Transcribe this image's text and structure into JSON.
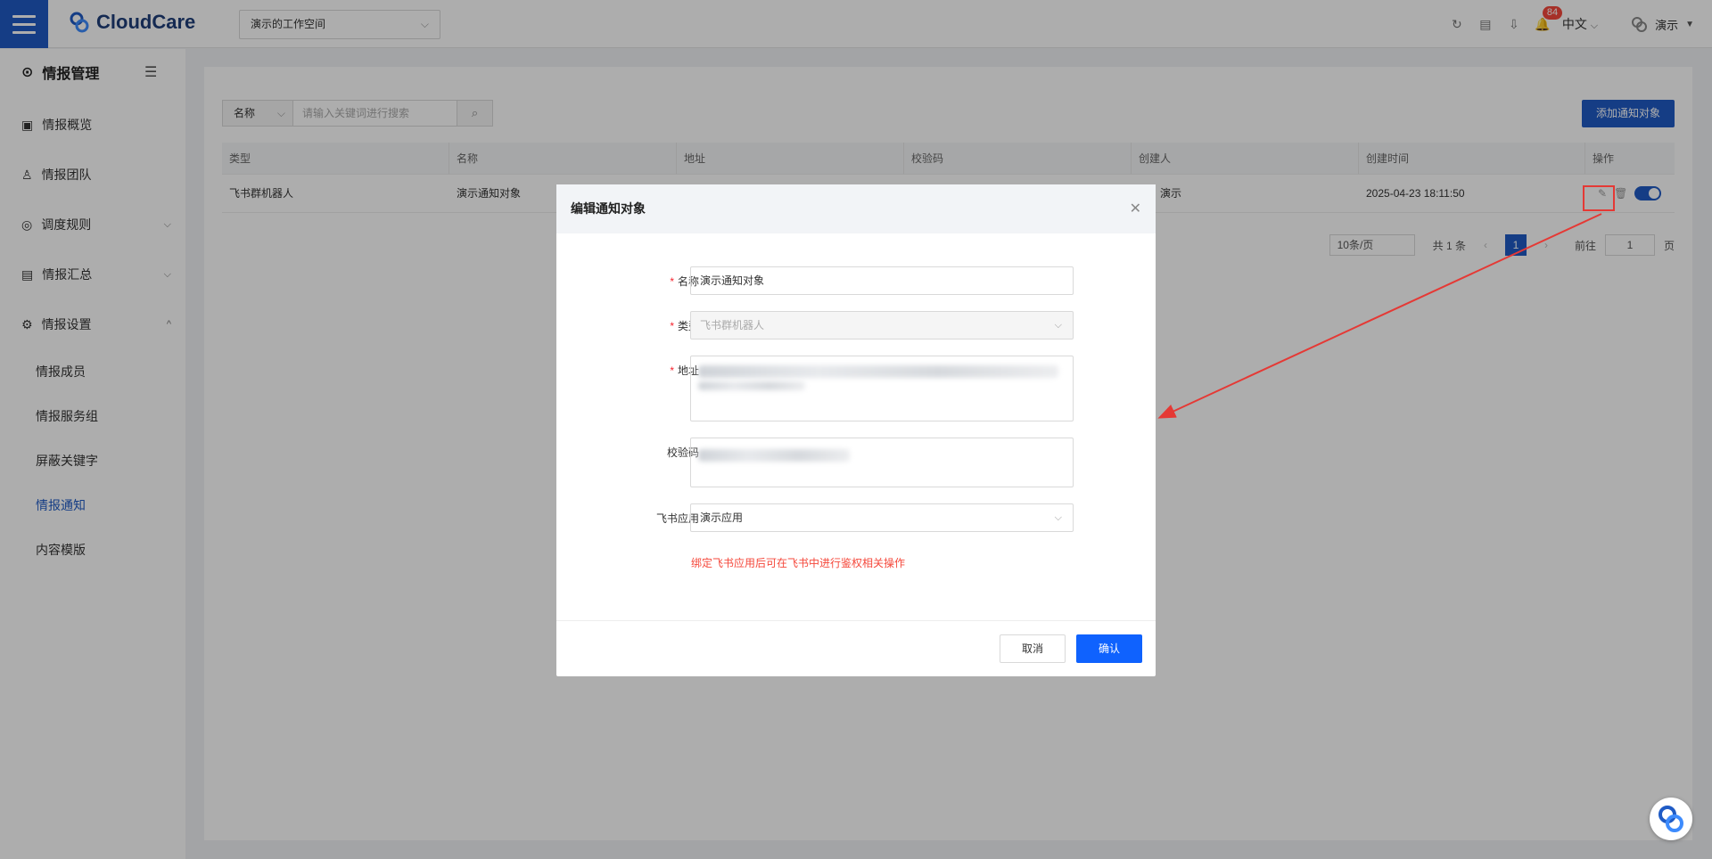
{
  "header": {
    "logo_text": "CloudCare",
    "workspace": "演示的工作空间",
    "notification_count": "84",
    "language": "中文",
    "user": "演示"
  },
  "sidebar": {
    "title": "情报管理",
    "items": [
      {
        "label": "情报概览",
        "icon": "overview-icon"
      },
      {
        "label": "情报团队",
        "icon": "team-icon"
      },
      {
        "label": "调度规则",
        "icon": "compass-icon"
      },
      {
        "label": "情报汇总",
        "icon": "document-icon"
      },
      {
        "label": "情报设置",
        "icon": "settings-icon"
      }
    ],
    "sub_items": [
      "情报成员",
      "情报服务组",
      "屏蔽关键字",
      "情报通知",
      "内容模版"
    ],
    "active_sub": "情报通知"
  },
  "search": {
    "field": "名称",
    "placeholder": "请输入关键词进行搜索"
  },
  "add_button": "添加通知对象",
  "table": {
    "columns": [
      "类型",
      "名称",
      "地址",
      "校验码",
      "创建人",
      "创建时间",
      "操作"
    ],
    "rows": [
      {
        "type": "飞书群机器人",
        "name": "演示通知对象",
        "creator": "演示",
        "created_at": "2025-04-23 18:11:50",
        "enabled": true
      }
    ]
  },
  "pagination": {
    "page_size": "10条/页",
    "total": "共 1 条",
    "current": "1",
    "goto_label": "前往",
    "goto_value": "1",
    "page_unit": "页"
  },
  "dialog": {
    "title": "编辑通知对象",
    "fields": {
      "name_label": "名称",
      "name_value": "演示通知对象",
      "type_label": "类型",
      "type_value": "飞书群机器人",
      "address_label": "地址",
      "token_label": "校验码",
      "app_label": "飞书应用",
      "app_value": "演示应用"
    },
    "hint": "绑定飞书应用后可在飞书中进行鉴权相关操作",
    "cancel": "取消",
    "confirm": "确认"
  },
  "colors": {
    "primary": "#1f5bc5",
    "confirm": "#0f62fe",
    "required": "#f5222d",
    "hint": "#f5483b",
    "annotation": "#e53935"
  }
}
